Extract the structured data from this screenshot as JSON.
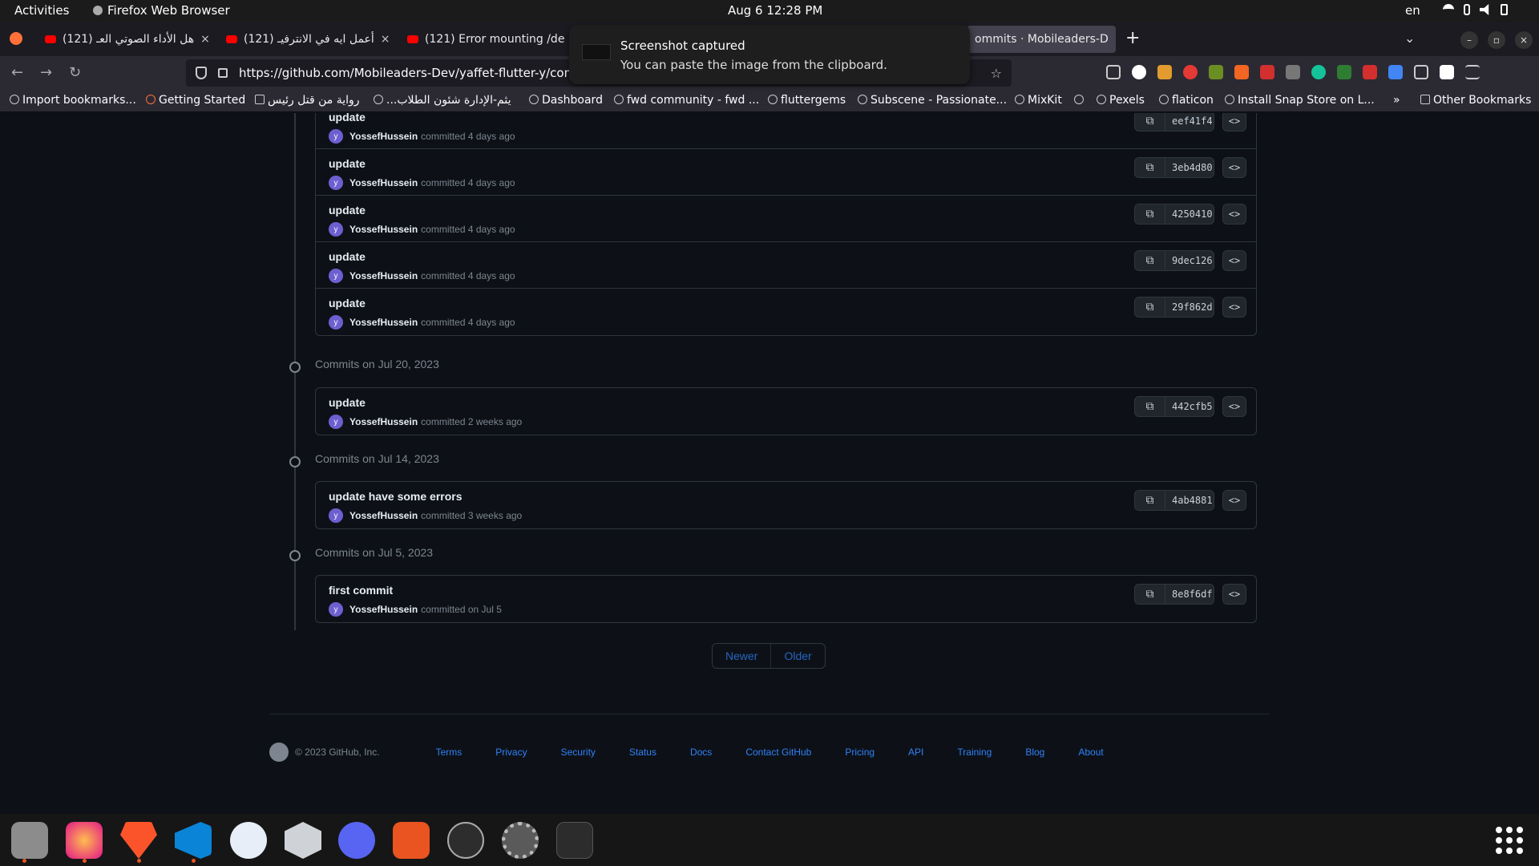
{
  "system": {
    "activities": "Activities",
    "app_name": "Firefox Web Browser",
    "clock": "Aug 6  12:28 PM",
    "lang": "en"
  },
  "tabs": [
    {
      "label": "(121) هل الأداء الصوتي العـ"
    },
    {
      "label": "(121) أعمل ايه في الانترفيـ"
    },
    {
      "label": "(121) Error mounting /de"
    },
    {
      "label": "ommits · Mobileaders-D"
    }
  ],
  "toast": {
    "title": "Screenshot captured",
    "body": "You can paste the image from the clipboard."
  },
  "url": "https://github.com/Mobileaders-Dev/yaffet-flutter-y/commi",
  "bookmarks": [
    "Import bookmarks...",
    "Getting Started",
    "رواية من قتل رئيس",
    "...يثم-الإدارة شئون الطلاب",
    "Dashboard",
    "fwd community - fwd ...",
    "fluttergems",
    "Subscene - Passionate...",
    "MixKit",
    "",
    "Pexels",
    "flaticon",
    "Install Snap Store on L...",
    "Other Bookmarks"
  ],
  "group1": {
    "commits": [
      {
        "message": "update",
        "author": "YossefHussein",
        "when": "committed 4 days ago",
        "sha": "eef41f4"
      },
      {
        "message": "update",
        "author": "YossefHussein",
        "when": "committed 4 days ago",
        "sha": "3eb4d80"
      },
      {
        "message": "update",
        "author": "YossefHussein",
        "when": "committed 4 days ago",
        "sha": "4250410"
      },
      {
        "message": "update",
        "author": "YossefHussein",
        "when": "committed 4 days ago",
        "sha": "9dec126"
      },
      {
        "message": "update",
        "author": "YossefHussein",
        "when": "committed 4 days ago",
        "sha": "29f862d"
      }
    ]
  },
  "group2": {
    "header": "Commits on Jul 20, 2023",
    "commits": [
      {
        "message": "update",
        "author": "YossefHussein",
        "when": "committed 2 weeks ago",
        "sha": "442cfb5"
      }
    ]
  },
  "group3": {
    "header": "Commits on Jul 14, 2023",
    "commits": [
      {
        "message": "update have some errors",
        "author": "YossefHussein",
        "when": "committed 3 weeks ago",
        "sha": "4ab4881"
      }
    ]
  },
  "group4": {
    "header": "Commits on Jul 5, 2023",
    "commits": [
      {
        "message": "first commit",
        "author": "YossefHussein",
        "when": "committed on Jul 5",
        "sha": "8e8f6df"
      }
    ]
  },
  "avatar_letter": "y",
  "browse_glyph": "<>",
  "pager": {
    "newer": "Newer",
    "older": "Older"
  },
  "footer": {
    "copyright": "© 2023 GitHub, Inc.",
    "links": [
      "Terms",
      "Privacy",
      "Security",
      "Status",
      "Docs",
      "Contact GitHub",
      "Pricing",
      "API",
      "Training",
      "Blog",
      "About"
    ]
  }
}
